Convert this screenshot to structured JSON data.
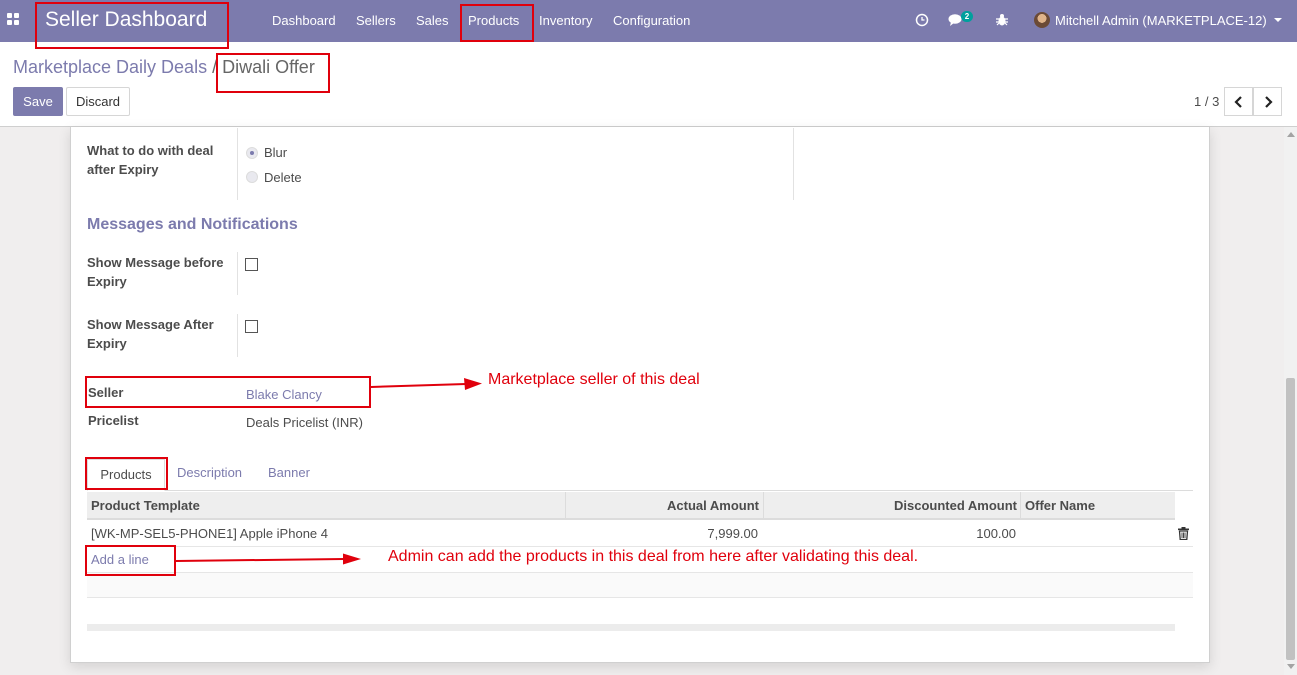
{
  "navbar": {
    "brand": "Seller Dashboard",
    "menu": [
      "Dashboard",
      "Sellers",
      "Sales",
      "Products",
      "Inventory",
      "Configuration"
    ],
    "active_menu": "Products",
    "messages_count": "2",
    "user_name": "Mitchell Admin (MARKETPLACE-12)"
  },
  "breadcrumb": {
    "parent": "Marketplace Daily Deals",
    "separator": "/",
    "current": "Diwali Offer"
  },
  "actions": {
    "save": "Save",
    "discard": "Discard"
  },
  "pager": {
    "value": "1 / 3"
  },
  "form": {
    "expiry_action": {
      "label": "What to do with deal after Expiry",
      "options": [
        "Blur",
        "Delete"
      ],
      "selected": "Blur"
    },
    "section_title": "Messages and Notifications",
    "show_message_before": {
      "label": "Show Message before Expiry",
      "checked": false
    },
    "show_message_after": {
      "label": "Show Message After Expiry",
      "checked": false
    },
    "seller": {
      "label": "Seller",
      "value": "Blake Clancy"
    },
    "pricelist": {
      "label": "Pricelist",
      "value": "Deals Pricelist (INR)"
    }
  },
  "tabs": [
    "Products",
    "Description",
    "Banner"
  ],
  "active_tab": "Products",
  "products_table": {
    "columns": [
      "Product Template",
      "Actual Amount",
      "Discounted Amount",
      "Offer Name"
    ],
    "rows": [
      {
        "product": "[WK-MP-SEL5-PHONE1] Apple iPhone 4",
        "actual": "7,999.00",
        "discounted": "100.00",
        "offer": ""
      }
    ],
    "add_line": "Add a line"
  },
  "annotations": {
    "seller_note": "Marketplace seller of this deal",
    "products_note": "Admin can add the products in this deal from here after validating this deal."
  },
  "colors": {
    "primary": "#7c7bad",
    "annotation": "#e0000c",
    "badge": "#00a09d"
  }
}
